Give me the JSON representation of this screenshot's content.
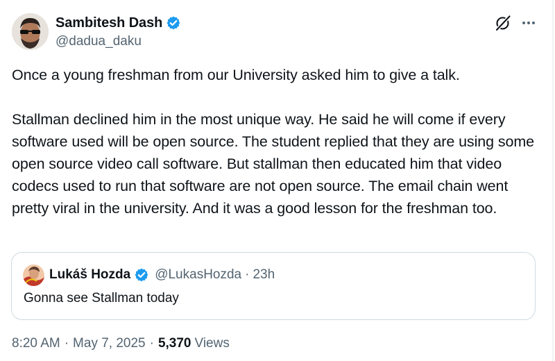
{
  "author": {
    "name": "Sambitesh Dash",
    "handle": "@dadua_daku",
    "verified": true
  },
  "tweet": {
    "text": "Once a young freshman from our University asked him to give a talk.\n\nStallman declined him in the most unique way. He said he will come if every software used will be open source. The student replied that they are using some open source video call software. But stallman then educated him that video codecs used to run that software are not open source. The email chain went pretty viral in the university. And it was a good lesson for the freshman too."
  },
  "quoted": {
    "name": "Lukáš Hozda",
    "handle": "@LukasHozda",
    "separator": "·",
    "time": "23h",
    "text": "Gonna see Stallman today",
    "verified": true
  },
  "meta": {
    "time": "8:20 AM",
    "separator": "·",
    "date": "May 7, 2025",
    "views_count": "5,370",
    "views_label": "Views"
  },
  "icons": {
    "verified_badge": "verified-badge-icon",
    "grok": "grok-icon",
    "more": "more-icon"
  },
  "colors": {
    "verified": "#1d9bf0",
    "secondary_text": "#536471",
    "border": "#cfd9de"
  }
}
